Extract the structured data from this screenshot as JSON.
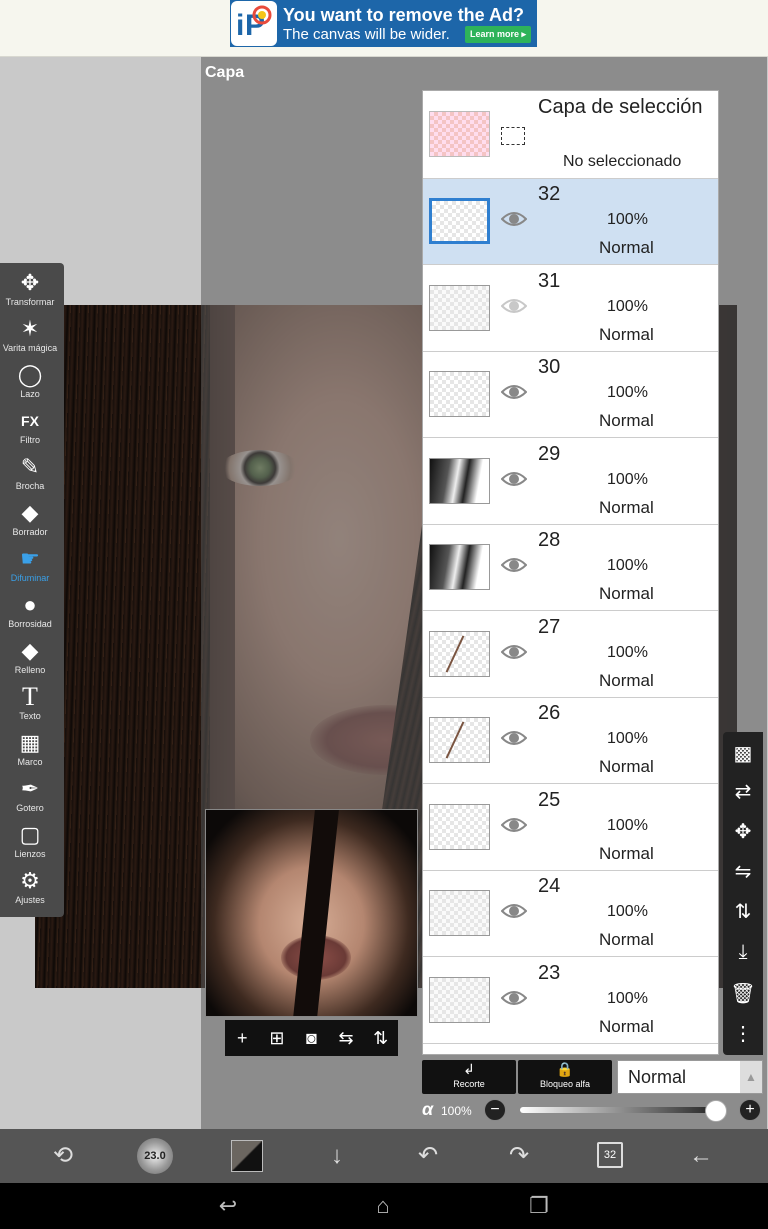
{
  "ad": {
    "title": "You want to remove the Ad?",
    "subtitle": "The canvas will be wider.",
    "button": "Learn more ▸"
  },
  "toolbar": {
    "tools": [
      {
        "label": "Transformar",
        "icon": "move-icon"
      },
      {
        "label": "Varita mágica",
        "icon": "magic-wand-icon"
      },
      {
        "label": "Lazo",
        "icon": "lasso-icon"
      },
      {
        "label": "Filtro",
        "icon": "fx-icon"
      },
      {
        "label": "Brocha",
        "icon": "brush-icon"
      },
      {
        "label": "Borrador",
        "icon": "eraser-icon"
      },
      {
        "label": "Difuminar",
        "icon": "blur-icon"
      },
      {
        "label": "Borrosidad",
        "icon": "drop-icon"
      },
      {
        "label": "Relleno",
        "icon": "fill-icon"
      },
      {
        "label": "Texto",
        "icon": "text-icon"
      },
      {
        "label": "Marco",
        "icon": "frame-icon"
      },
      {
        "label": "Gotero",
        "icon": "eyedropper-icon"
      },
      {
        "label": "Lienzos",
        "icon": "canvas-icon"
      },
      {
        "label": "Ajustes",
        "icon": "gear-icon"
      }
    ],
    "active_tool": "Difuminar"
  },
  "layer_panel": {
    "title": "Capa",
    "selection_layer": {
      "title": "Capa de selección",
      "status": "No seleccionado"
    },
    "layers": [
      {
        "number": "32",
        "opacity": "100%",
        "blend": "Normal",
        "selected": true,
        "visible": true
      },
      {
        "number": "31",
        "opacity": "100%",
        "blend": "Normal",
        "selected": false,
        "visible": false
      },
      {
        "number": "30",
        "opacity": "100%",
        "blend": "Normal",
        "selected": false,
        "visible": true
      },
      {
        "number": "29",
        "opacity": "100%",
        "blend": "Normal",
        "selected": false,
        "visible": true
      },
      {
        "number": "28",
        "opacity": "100%",
        "blend": "Normal",
        "selected": false,
        "visible": true
      },
      {
        "number": "27",
        "opacity": "100%",
        "blend": "Normal",
        "selected": false,
        "visible": true
      },
      {
        "number": "26",
        "opacity": "100%",
        "blend": "Normal",
        "selected": false,
        "visible": true
      },
      {
        "number": "25",
        "opacity": "100%",
        "blend": "Normal",
        "selected": false,
        "visible": true
      },
      {
        "number": "24",
        "opacity": "100%",
        "blend": "Normal",
        "selected": false,
        "visible": true
      },
      {
        "number": "23",
        "opacity": "100%",
        "blend": "Normal",
        "selected": false,
        "visible": true
      }
    ],
    "clip_label": "Recorte",
    "alpha_lock_label": "Bloqueo alfa",
    "blend_mode": "Normal",
    "alpha_symbol": "α",
    "opacity": "100%",
    "opacity_value": 1.0
  },
  "right_tools": [
    "checker-icon",
    "swap-layer-icon",
    "move-icon",
    "flip-horizontal-icon",
    "flip-vertical-icon",
    "merge-down-icon",
    "trash-icon",
    "more-icon"
  ],
  "bottom_bar": {
    "brush_size": "23.0",
    "layers_count": "32"
  },
  "colors": {
    "accent": "#3aa0e8",
    "selected_row": "#cfe0f2",
    "ad_bg": "#1d66a9"
  }
}
